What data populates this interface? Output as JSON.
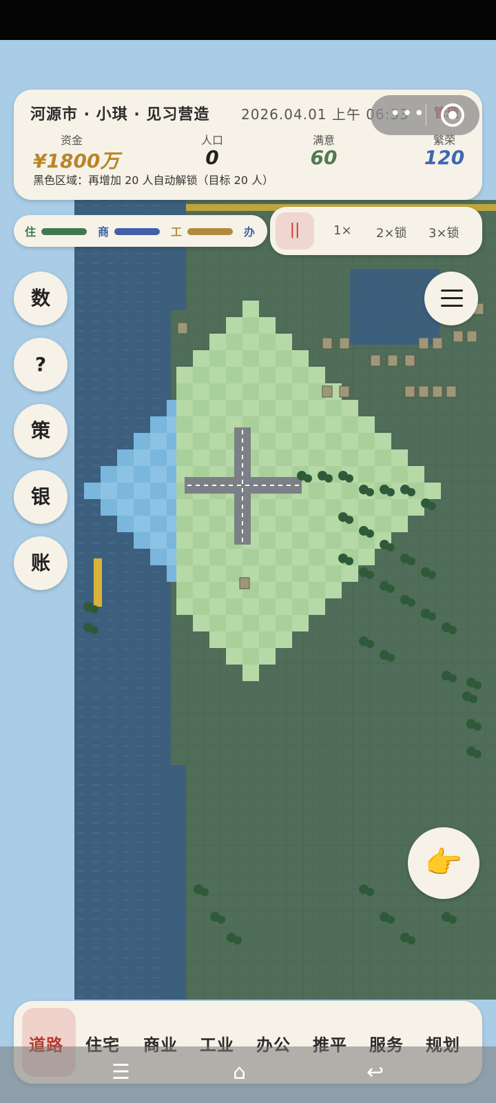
{
  "hud": {
    "city_line": "河源市 · 小琪 · 见习营造",
    "datetime": "2026.04.01 上午 06:33",
    "mini_program_label": "管理",
    "funds_label": "资金",
    "funds_value": "¥1800万",
    "population_label": "人口",
    "population_value": "0",
    "satisfaction_label": "满意",
    "satisfaction_value": "60",
    "prosperity_label": "繁荣",
    "prosperity_value": "120",
    "notice": "黑色区域：再增加 20 人自动解锁（目标 20 人）"
  },
  "legend": {
    "items": [
      {
        "label": "住",
        "color": "#3f7a4f"
      },
      {
        "label": "商",
        "color": "#3f5fa8"
      },
      {
        "label": "工",
        "color": "#b08a3a"
      },
      {
        "label": "办",
        "color": "#3f5fa8"
      }
    ]
  },
  "speed": {
    "pause_label": "||",
    "options": [
      "1×",
      "2×锁",
      "3×锁"
    ]
  },
  "side_buttons": [
    "数",
    "?",
    "策",
    "银",
    "账"
  ],
  "toolbar": {
    "tools": [
      "道路",
      "住宅",
      "商业",
      "工业",
      "办公",
      "推平",
      "服务",
      "规划"
    ],
    "active": "道路"
  },
  "icons": {
    "menu": "hamburger-menu-icon",
    "hand": "pointing-hand-icon",
    "nav_menu": "nav-menu-icon",
    "nav_home": "nav-home-icon",
    "nav_back": "nav-back-icon",
    "capsule_more": "more-dots-icon",
    "capsule_close": "close-circle-icon"
  },
  "colors": {
    "deep_water": "#3c5f7e",
    "land": "#4f6d58",
    "buildable": "#a9d09a",
    "shallow_water": "#7bb6dc",
    "funds": "#b8862b",
    "satisfaction": "#4e7a52",
    "prosperity": "#3f66b0"
  }
}
